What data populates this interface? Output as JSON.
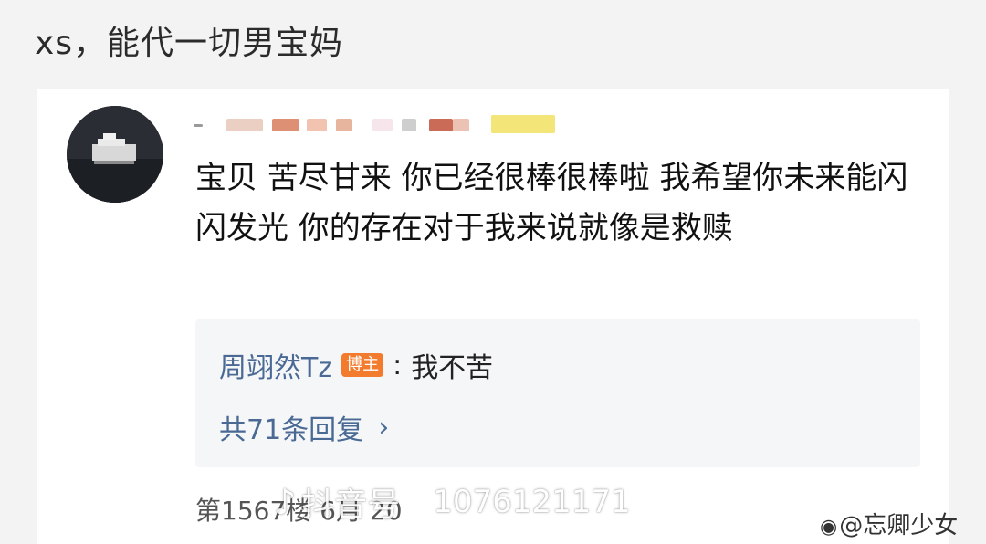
{
  "caption": "xs，能代一切男宝妈",
  "comment": {
    "text": "宝贝 苦尽甘来 你已经很棒很棒啦 我希望你未来能闪闪发光 你的存在对于我来说就像是救赎",
    "reply": {
      "author": "周翊然Tz",
      "badge": "博主",
      "colon": ":",
      "text": "我不苦"
    },
    "more_replies": "共71条回复",
    "meta": "第1567楼 6月 20"
  },
  "watermark": {
    "icon": "douyin-note-icon",
    "app": "抖音号",
    "uid": "1076121171"
  },
  "credit": {
    "icon": "weibo-icon",
    "text": "@忘卿少女"
  },
  "colors": {
    "link": "#4a6a95",
    "badge": "#f37b2d",
    "reply_bg": "#f5f6f8"
  }
}
